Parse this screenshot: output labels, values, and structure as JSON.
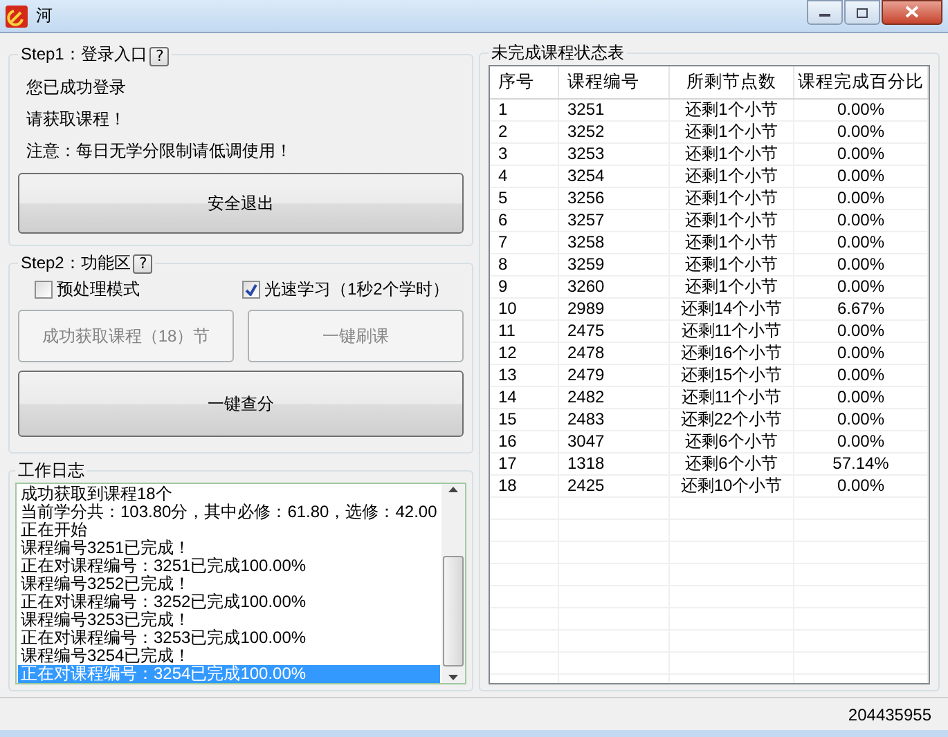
{
  "window": {
    "title": "河"
  },
  "step1": {
    "legend": "Step1：登录入口",
    "help": "?",
    "lines": [
      "您已成功登录",
      "请获取课程！",
      "注意：每日无学分限制请低调使用！"
    ],
    "logout_button": {
      "label": "安全退出",
      "disabled": false
    }
  },
  "step2": {
    "legend": "Step2：功能区",
    "help": "?",
    "options": [
      {
        "label": "预处理模式",
        "checked": false
      },
      {
        "label": "光速学习（1秒2个学时）",
        "checked": true
      }
    ],
    "buttons": [
      {
        "label": "成功获取课程（18）节",
        "disabled": true
      },
      {
        "label": "一键刷课",
        "disabled": true
      },
      {
        "label": "一键查分",
        "disabled": false
      }
    ]
  },
  "log": {
    "legend": "工作日志",
    "lines": [
      {
        "text": "成功获取到课程18个",
        "selected": false
      },
      {
        "text": "当前学分共：103.80分，其中必修：61.80，选修：42.00",
        "selected": false
      },
      {
        "text": "正在开始",
        "selected": false
      },
      {
        "text": "课程编号3251已完成！",
        "selected": false
      },
      {
        "text": "正在对课程编号：3251已完成100.00%",
        "selected": false
      },
      {
        "text": "课程编号3252已完成！",
        "selected": false
      },
      {
        "text": "正在对课程编号：3252已完成100.00%",
        "selected": false
      },
      {
        "text": "课程编号3253已完成！",
        "selected": false
      },
      {
        "text": "正在对课程编号：3253已完成100.00%",
        "selected": false
      },
      {
        "text": "课程编号3254已完成！",
        "selected": false
      },
      {
        "text": "正在对课程编号：3254已完成100.00%",
        "selected": true
      }
    ]
  },
  "courses": {
    "legend": "未完成课程状态表",
    "columns": [
      "序号",
      "课程编号",
      "所剩节点数",
      "课程完成百分比"
    ],
    "rows": [
      [
        "1",
        "3251",
        "还剩1个小节",
        "0.00%"
      ],
      [
        "2",
        "3252",
        "还剩1个小节",
        "0.00%"
      ],
      [
        "3",
        "3253",
        "还剩1个小节",
        "0.00%"
      ],
      [
        "4",
        "3254",
        "还剩1个小节",
        "0.00%"
      ],
      [
        "5",
        "3256",
        "还剩1个小节",
        "0.00%"
      ],
      [
        "6",
        "3257",
        "还剩1个小节",
        "0.00%"
      ],
      [
        "7",
        "3258",
        "还剩1个小节",
        "0.00%"
      ],
      [
        "8",
        "3259",
        "还剩1个小节",
        "0.00%"
      ],
      [
        "9",
        "3260",
        "还剩1个小节",
        "0.00%"
      ],
      [
        "10",
        "2989",
        "还剩14个小节",
        "6.67%"
      ],
      [
        "11",
        "2475",
        "还剩11个小节",
        "0.00%"
      ],
      [
        "12",
        "2478",
        "还剩16个小节",
        "0.00%"
      ],
      [
        "13",
        "2479",
        "还剩15个小节",
        "0.00%"
      ],
      [
        "14",
        "2482",
        "还剩11个小节",
        "0.00%"
      ],
      [
        "15",
        "2483",
        "还剩22个小节",
        "0.00%"
      ],
      [
        "16",
        "3047",
        "还剩6个小节",
        "0.00%"
      ],
      [
        "17",
        "1318",
        "还剩6个小节",
        "57.14%"
      ],
      [
        "18",
        "2425",
        "还剩10个小节",
        "0.00%"
      ]
    ]
  },
  "status_bar": {
    "text": "204435955"
  }
}
